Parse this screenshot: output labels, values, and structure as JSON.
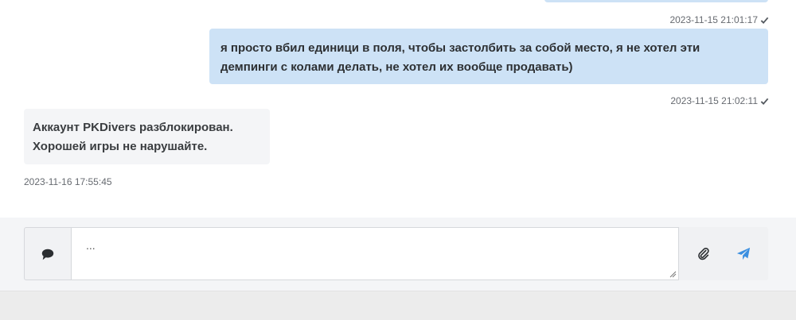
{
  "messages": [
    {
      "direction": "outgoing",
      "timestamp": "2023-11-15 21:01:17",
      "read": true
    },
    {
      "direction": "outgoing",
      "text": "я просто вбил единици в поля, чтобы застолбить за собой место, я не хотел эти демпинги с колами делать, не хотел их вообще продавать)",
      "timestamp": "2023-11-15 21:02:11",
      "read": true
    },
    {
      "direction": "incoming",
      "lines": [
        "Аккаунт PKDivers разблокирован.",
        "Хорошей игры не нарушайте."
      ],
      "timestamp": "2023-11-16 17:55:45"
    }
  ],
  "composer": {
    "placeholder": "...",
    "value": "",
    "left_icon": "comment-icon",
    "attach_icon": "paperclip-icon",
    "send_icon": "paper-plane-icon"
  },
  "colors": {
    "outgoing_bubble": "#cde2f6",
    "incoming_bubble": "#f4f5f7",
    "send_accent": "#3b8fe0",
    "meta_text": "#666a70"
  }
}
